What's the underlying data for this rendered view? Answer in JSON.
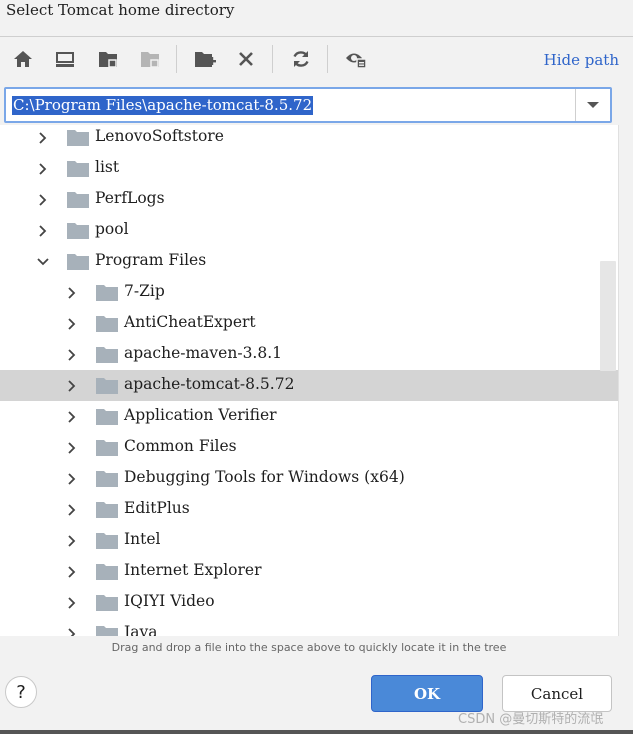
{
  "dialog": {
    "title": "Select Tomcat home directory",
    "hide_path_label": "Hide path",
    "path_value": "C:\\Program Files\\apache-tomcat-8.5.72",
    "hint": "Drag and drop a file into the space above to quickly locate it in the tree",
    "ok_label": "OK",
    "cancel_label": "Cancel",
    "help_label": "?",
    "watermark": "CSDN @曼切斯特的流氓"
  },
  "toolbar": {
    "buttons": [
      "home-icon",
      "desktop-icon",
      "project-folder-icon",
      "module-folder-icon",
      "new-folder-icon",
      "delete-icon",
      "refresh-icon",
      "show-hidden-icon"
    ]
  },
  "tree": {
    "rows": [
      {
        "label": "LenovoSoftstore",
        "level": 0,
        "expanded": false,
        "selected": false
      },
      {
        "label": "list",
        "level": 0,
        "expanded": false,
        "selected": false
      },
      {
        "label": "PerfLogs",
        "level": 0,
        "expanded": false,
        "selected": false
      },
      {
        "label": "pool",
        "level": 0,
        "expanded": false,
        "selected": false
      },
      {
        "label": "Program Files",
        "level": 0,
        "expanded": true,
        "selected": false
      },
      {
        "label": "7-Zip",
        "level": 1,
        "expanded": false,
        "selected": false
      },
      {
        "label": "AntiCheatExpert",
        "level": 1,
        "expanded": false,
        "selected": false
      },
      {
        "label": "apache-maven-3.8.1",
        "level": 1,
        "expanded": false,
        "selected": false
      },
      {
        "label": "apache-tomcat-8.5.72",
        "level": 1,
        "expanded": false,
        "selected": true
      },
      {
        "label": "Application Verifier",
        "level": 1,
        "expanded": false,
        "selected": false
      },
      {
        "label": "Common Files",
        "level": 1,
        "expanded": false,
        "selected": false
      },
      {
        "label": "Debugging Tools for Windows (x64)",
        "level": 1,
        "expanded": false,
        "selected": false
      },
      {
        "label": "EditPlus",
        "level": 1,
        "expanded": false,
        "selected": false
      },
      {
        "label": "Intel",
        "level": 1,
        "expanded": false,
        "selected": false
      },
      {
        "label": "Internet Explorer",
        "level": 1,
        "expanded": false,
        "selected": false
      },
      {
        "label": "IQIYI Video",
        "level": 1,
        "expanded": false,
        "selected": false
      },
      {
        "label": "Java",
        "level": 1,
        "expanded": false,
        "selected": false
      }
    ]
  },
  "colors": {
    "accent": "#2f65ca",
    "selection": "#d4d4d4",
    "folder": "#a7b1ba"
  }
}
